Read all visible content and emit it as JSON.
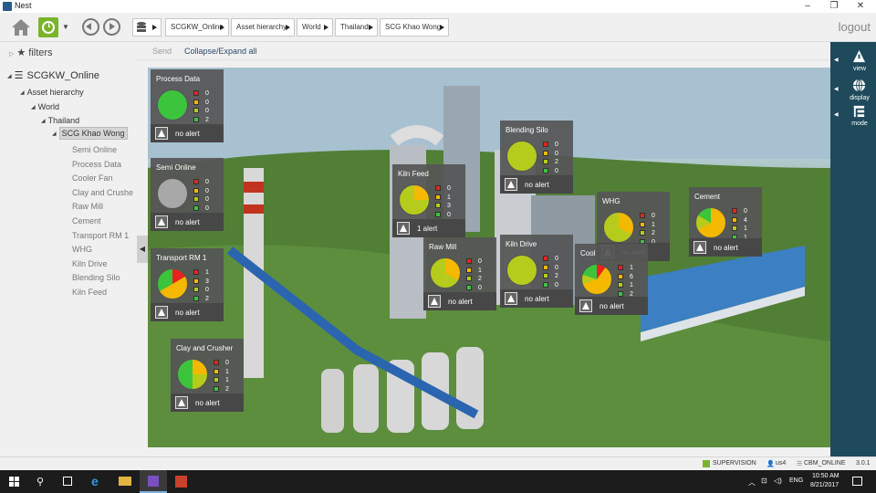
{
  "window": {
    "title": "Nest",
    "minimize": "–",
    "maximize": "❐",
    "close": "✕"
  },
  "toolbar": {
    "breadcrumbs": [
      "SCGKW_Online",
      "Asset hierarchy",
      "World",
      "Thailand",
      "SCG Khao Wong"
    ],
    "logout": "logout"
  },
  "sidebar": {
    "filters_label": "filters",
    "tree": {
      "root": "SCGKW_Online",
      "asset_hierarchy": "Asset hierarchy",
      "world": "World",
      "thailand": "Thailand",
      "site": "SCG Khao Wong",
      "children": [
        "Semi Online",
        "Process Data",
        "Cooler Fan",
        "Clay and Crushe",
        "Raw Mill",
        "Cement",
        "Transport RM 1",
        "WHG",
        "Kiln Drive",
        "Blending Silo",
        "Kiln Feed"
      ]
    }
  },
  "main": {
    "send_label": "Send",
    "collapse_label": "Collapse/Expand all"
  },
  "status_colors": {
    "critical": "#e8231e",
    "warning": "#f5b800",
    "minor": "#b6cc1c",
    "ok": "#3dc43d",
    "unknown": "#a8a8a8"
  },
  "widgets": [
    {
      "title": "Process Data",
      "counts": [
        "0",
        "0",
        "0",
        "2"
      ],
      "alert": "no alert"
    },
    {
      "title": "Semi Online",
      "counts": [
        "0",
        "0",
        "0",
        "0"
      ],
      "alert": "no alert"
    },
    {
      "title": "Transport RM 1",
      "counts": [
        "1",
        "3",
        "0",
        "2"
      ],
      "alert": "no alert"
    },
    {
      "title": "Clay and Crusher",
      "counts": [
        "0",
        "1",
        "1",
        "2"
      ],
      "alert": "no alert"
    },
    {
      "title": "Kiln Feed",
      "counts": [
        "0",
        "1",
        "3",
        "0"
      ],
      "alert": "1 alert"
    },
    {
      "title": "Blending Silo",
      "counts": [
        "0",
        "0",
        "2",
        "0"
      ],
      "alert": "no alert"
    },
    {
      "title": "Raw Mill",
      "counts": [
        "0",
        "1",
        "2",
        "0"
      ],
      "alert": "no alert"
    },
    {
      "title": "Kiln Drive",
      "counts": [
        "0",
        "0",
        "2",
        "0"
      ],
      "alert": "no alert"
    },
    {
      "title": "WHG",
      "counts": [
        "0",
        "1",
        "2",
        "0"
      ],
      "alert": "no alert"
    },
    {
      "title": "Cement",
      "counts": [
        "0",
        "4",
        "1",
        "1"
      ],
      "alert": "no alert"
    },
    {
      "title": "Cool",
      "counts": [
        "1",
        "6",
        "1",
        "2"
      ],
      "alert": "no alert"
    }
  ],
  "right_panel": {
    "view": "view",
    "display": "display",
    "mode": "mode"
  },
  "statusbar": {
    "supervision": "SUPERVISION",
    "user": "us4",
    "db": "CBM_ONLINE",
    "version": "3.0.1"
  },
  "taskbar": {
    "tray_lang": "ENG",
    "time": "10:50 AM",
    "date": "8/21/2017"
  }
}
